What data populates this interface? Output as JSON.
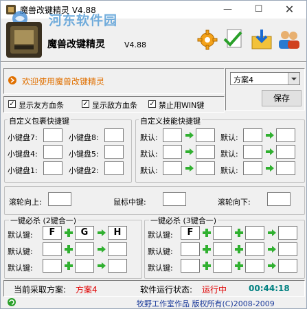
{
  "window": {
    "title": "魔兽改键精灵 V4.88",
    "watermark": "河东软件园"
  },
  "banner": {
    "app_name": "魔兽改键精灵",
    "version": "V4.88"
  },
  "toolbar_icons": [
    "gear-icon",
    "checkmark-document-icon",
    "download-folder-icon",
    "users-icon"
  ],
  "welcome": "欢迎使用魔兽改键精灵",
  "scheme": {
    "selected": "方案4",
    "save_label": "保存"
  },
  "checkboxes": [
    {
      "label": "显示友方血条",
      "checked": true
    },
    {
      "label": "显示敌方血条",
      "checked": true
    },
    {
      "label": "禁止用WIN键",
      "checked": true
    }
  ],
  "inventory": {
    "title": "自定义包裹快捷键",
    "slots": [
      {
        "label": "小键盘7:",
        "value": ""
      },
      {
        "label": "小键盘8:",
        "value": ""
      },
      {
        "label": "小键盘4:",
        "value": ""
      },
      {
        "label": "小键盘5:",
        "value": ""
      },
      {
        "label": "小键盘1:",
        "value": ""
      },
      {
        "label": "小键盘2:",
        "value": ""
      }
    ]
  },
  "skills": {
    "title": "自定义技能快捷键",
    "default_label": "默认:",
    "rows": [
      {
        "from": "",
        "to": ""
      },
      {
        "from": "",
        "to": ""
      },
      {
        "from": "",
        "to": ""
      },
      {
        "from": "",
        "to": ""
      },
      {
        "from": "",
        "to": ""
      },
      {
        "from": "",
        "to": ""
      }
    ]
  },
  "mouse": {
    "wheel_up": "滚轮向上:",
    "middle": "鼠标中键:",
    "wheel_down": "滚轮向下:",
    "wheel_up_value": "",
    "middle_value": "",
    "wheel_down_value": ""
  },
  "combo2": {
    "title": "一键必杀 (2键合一)",
    "label": "默认键:",
    "rows": [
      {
        "key": "F",
        "combo1": "G",
        "target": "H"
      },
      {
        "key": "",
        "combo1": "",
        "target": ""
      },
      {
        "key": "",
        "combo1": "",
        "target": ""
      }
    ]
  },
  "combo3": {
    "title": "一键必杀 (3键合一)",
    "label": "默认键:",
    "rows": [
      {
        "key": "F",
        "combo1": "",
        "combo2": "",
        "target": ""
      },
      {
        "key": "",
        "combo1": "",
        "combo2": "",
        "target": ""
      },
      {
        "key": "",
        "combo1": "",
        "combo2": "",
        "target": ""
      }
    ]
  },
  "status": {
    "scheme_label": "当前采取方案:",
    "scheme_value": "方案4",
    "run_label": "软件运行状态:",
    "run_value": "运行中",
    "time": "00:44:18"
  },
  "footer": {
    "credit": "牧野工作室作品  版权所有(C)2008-2009"
  },
  "colors": {
    "orange": "#e07000",
    "red": "#e00000",
    "teal": "#008080",
    "green": "#30b030",
    "blue": "#1a3a9a"
  }
}
